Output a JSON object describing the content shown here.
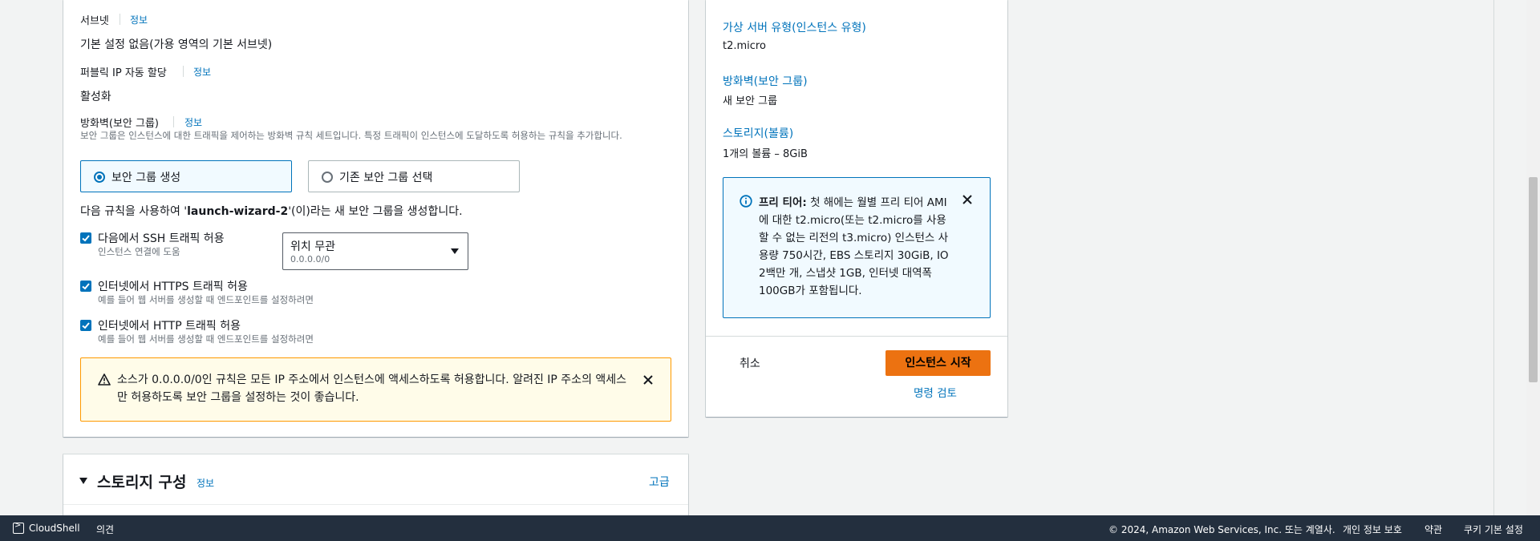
{
  "network": {
    "subnet_label": "서브넷",
    "subnet_info": "정보",
    "subnet_value": "기본 설정 없음(가용 영역의 기본 서브넷)",
    "public_ip_label": "퍼블릭 IP 자동 할당",
    "public_ip_info": "정보",
    "public_ip_value": "활성화",
    "firewall_label": "방화벽(보안 그룹)",
    "firewall_info": "정보",
    "firewall_desc": "보안 그룹은 인스턴스에 대한 트래픽을 제어하는 방화벽 규칙 세트입니다. 특정 트래픽이 인스턴스에 도달하도록 허용하는 규칙을 추가합니다.",
    "radio_create": "보안 그룹 생성",
    "radio_existing": "기존 보안 그룹 선택",
    "rule_prefix": "다음 규칙을 사용하여 '",
    "rule_name": "launch-wizard-2",
    "rule_suffix": "'(이)라는 새 보안 그룹을 생성합니다.",
    "ssh_label": "다음에서 SSH 트래픽 허용",
    "ssh_desc": "인스턴스 연결에 도움",
    "ssh_source_value": "위치 무관",
    "ssh_source_sub": "0.0.0.0/0",
    "https_label": "인터넷에서 HTTPS 트래픽 허용",
    "https_desc": "예를 들어 웹 서버를 생성할 때 엔드포인트를 설정하려면",
    "http_label": "인터넷에서 HTTP 트래픽 허용",
    "http_desc": "예를 들어 웹 서버를 생성할 때 엔드포인트를 설정하려면",
    "warning_text": "소스가 0.0.0.0/0인 규칙은 모든 IP 주소에서 인스턴스에 액세스하도록 허용합니다. 알려진 IP 주소의 액세스만 허용하도록 보안 그룹을 설정하는 것이 좋습니다."
  },
  "storage": {
    "title": "스토리지 구성",
    "info": "정보",
    "advanced": "고급"
  },
  "summary": {
    "instance_type_label": "가상 서버 유형(인스턴스 유형)",
    "instance_type_value": "t2.micro",
    "firewall_label": "방화벽(보안 그룹)",
    "firewall_value": "새 보안 그룹",
    "storage_label": "스토리지(볼륨)",
    "storage_value": "1개의 볼륨 – 8GiB",
    "free_tier_title": "프리 티어:",
    "free_tier_text": " 첫 해에는 월별 프리 티어 AMI에 대한 t2.micro(또는 t2.micro를 사용할 수 없는 리전의 t3.micro) 인스턴스 사용량 750시간, EBS 스토리지 30GiB, IO 2백만 개, 스냅샷 1GB, 인터넷 대역폭 100GB가 포함됩니다.",
    "cancel": "취소",
    "launch": "인스턴스 시작",
    "review_commands": "명령 검토"
  },
  "footer": {
    "cloudshell": "CloudShell",
    "feedback": "의견",
    "copyright": "© 2024, Amazon Web Services, Inc. 또는 계열사.",
    "privacy": "개인 정보 보호",
    "terms": "약관",
    "cookies": "쿠키 기본 설정"
  },
  "colors": {
    "accent": "#0073bb",
    "primary_button": "#ec7211",
    "warning_border": "#ff9900",
    "footer_bg": "#232f3e"
  }
}
